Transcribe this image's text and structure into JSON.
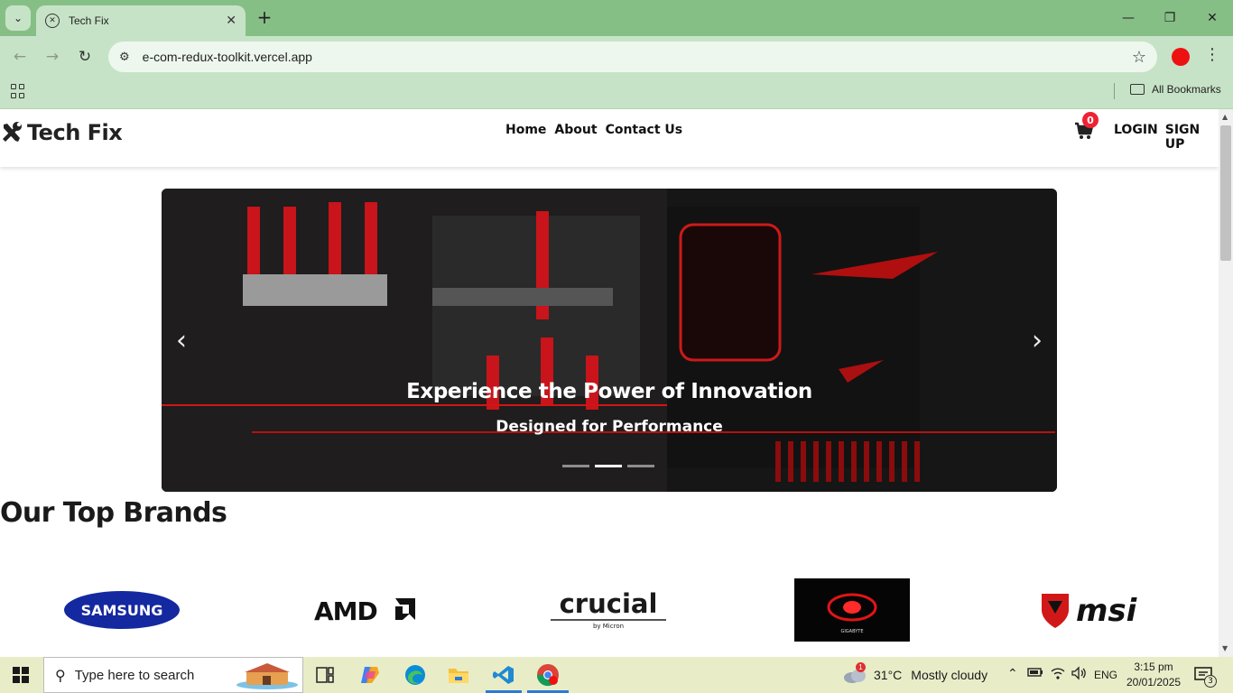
{
  "browser": {
    "tab_title": "Tech Fix",
    "url": "e-com-redux-toolkit.vercel.app",
    "bookmarks_folder": "All Bookmarks"
  },
  "site": {
    "logo_text": "Tech Fix",
    "nav": [
      {
        "label": "Home"
      },
      {
        "label": "About"
      },
      {
        "label": "Contact Us"
      }
    ],
    "cart_count": "0",
    "login_label": "LOGIN",
    "signup_label": "SIGN UP"
  },
  "carousel": {
    "title": "Experience the Power of Innovation",
    "subtitle": "Designed for Performance",
    "slide_count": 3,
    "active_index": 1
  },
  "brands": {
    "heading": "Our Top Brands",
    "items": [
      {
        "name": "SAMSUNG"
      },
      {
        "name": "AMD"
      },
      {
        "name": "crucial"
      },
      {
        "name": "by Micron"
      },
      {
        "name": "GIGABYTE"
      },
      {
        "name": "msi"
      }
    ]
  },
  "taskbar": {
    "search_placeholder": "Type here to search",
    "weather_temp": "31°C",
    "weather_desc": "Mostly cloudy",
    "weather_alerts": "1",
    "language": "ENG",
    "time": "3:15 pm",
    "date": "20/01/2025",
    "notification_count": "3"
  },
  "colors": {
    "browser_frame": "#86bf86",
    "browser_toolbar": "#c7e3c7",
    "cart_badge": "#ee2233",
    "taskbar": "#e8edc8"
  }
}
